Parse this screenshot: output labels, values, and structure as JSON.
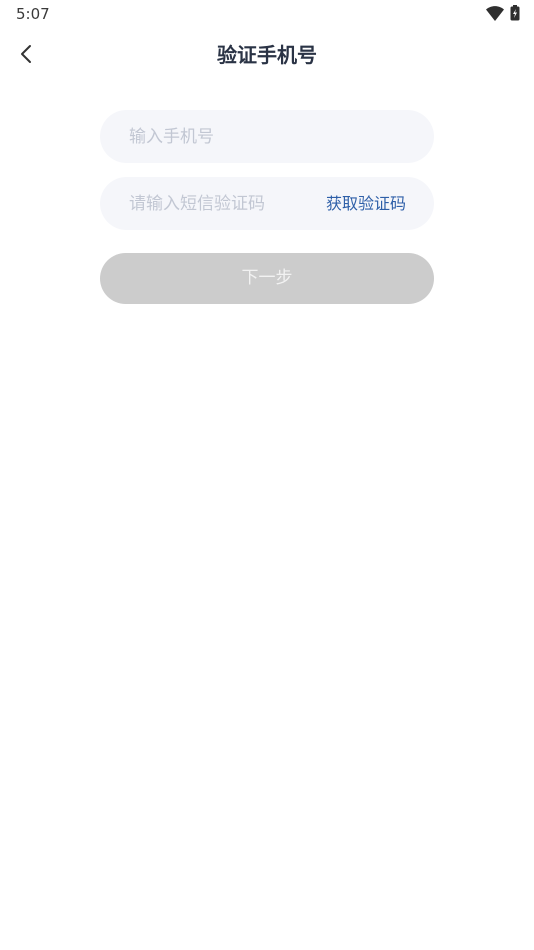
{
  "status_bar": {
    "time": "5:07",
    "icons": [
      "wifi-icon",
      "battery-charging-icon"
    ]
  },
  "header": {
    "back_icon": "chevron-left-icon",
    "title": "验证手机号"
  },
  "form": {
    "phone": {
      "value": "",
      "placeholder": "输入手机号"
    },
    "code": {
      "value": "",
      "placeholder": "请输入短信验证码"
    },
    "get_code_label": "获取验证码",
    "next_label": "下一步"
  },
  "colors": {
    "title": "#2a3345",
    "field_bg": "#f5f6fa",
    "placeholder": "#c2c7d3",
    "link": "#2e5fa8",
    "button_disabled": "#cccccc"
  }
}
